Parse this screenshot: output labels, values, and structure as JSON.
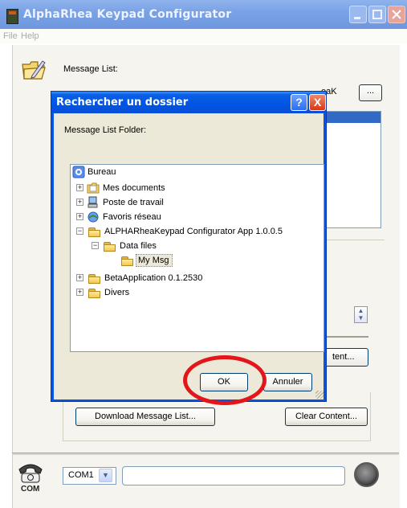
{
  "main_window": {
    "title": "AlphaRhea Keypad Configurator",
    "menu": [
      "File",
      "Help"
    ],
    "message_list_label": "Message List:",
    "path_tail": "eaK",
    "browse_label": "...",
    "clear_content_label": "Clear Content...",
    "clear_content_partial": "tent...",
    "download_label": "Download Message List...",
    "com_icon_text": "COM",
    "com_port": "COM1",
    "status_text": ""
  },
  "dialog": {
    "title": "Rechercher un dossier",
    "help_glyph": "?",
    "close_glyph": "X",
    "prompt": "Message List Folder:",
    "tree": [
      {
        "label": "Bureau"
      },
      {
        "label": "Mes documents",
        "expander": "+"
      },
      {
        "label": "Poste de travail",
        "expander": "+"
      },
      {
        "label": "Favoris réseau",
        "expander": "+"
      },
      {
        "label": "ALPHARheaKeypad Configurator App 1.0.0.5",
        "expander": "−"
      },
      {
        "label": "Data files",
        "expander": "−"
      },
      {
        "label": "My Msg",
        "selected": true
      },
      {
        "label": "BetaApplication 0.1.2530",
        "expander": "+"
      },
      {
        "label": "Divers",
        "expander": "+"
      }
    ],
    "ok_label": "OK",
    "cancel_label": "Annuler"
  },
  "icons": {
    "app": "app-icon",
    "folder": "folder-icon",
    "phone": "phone-com-icon",
    "led": "status-led-icon"
  },
  "colors": {
    "dialog_title": "#0054e3",
    "selection": "#316ac5",
    "highlight_circle": "#e3171b"
  }
}
